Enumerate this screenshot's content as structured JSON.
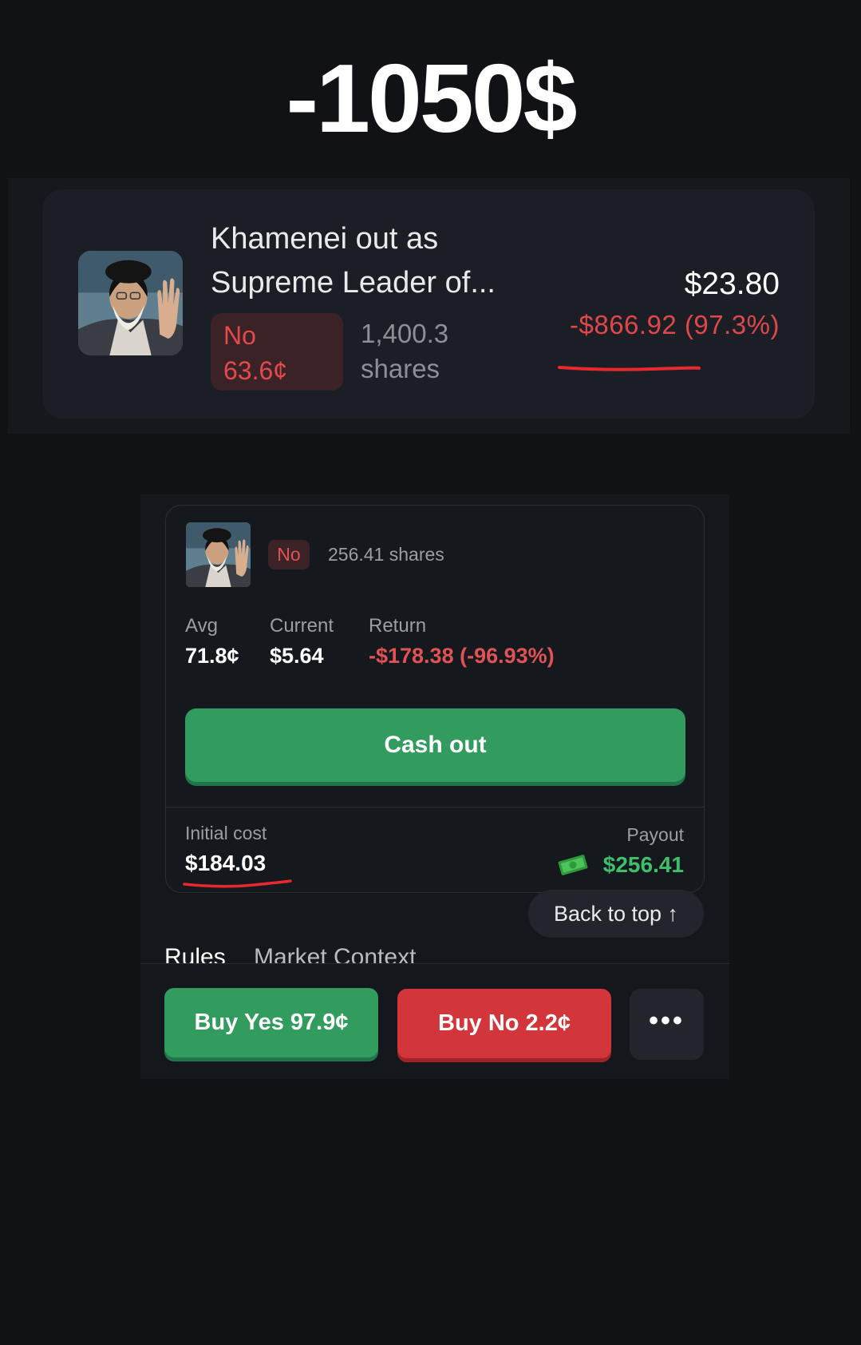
{
  "headline": "-1050$",
  "position_card": {
    "title": "Khamenei out as Supreme Leader of...",
    "outcome": "No",
    "outcome_price": "63.6¢",
    "shares_count": "1,400.3",
    "shares_label": "shares",
    "current_value": "$23.80",
    "pnl": "-$866.92 (97.3%)"
  },
  "detail_panel": {
    "outcome": "No",
    "shares": "256.41 shares",
    "stats": {
      "avg_label": "Avg",
      "avg_value": "71.8¢",
      "current_label": "Current",
      "current_value": "$5.64",
      "return_label": "Return",
      "return_value": "-$178.38 (-96.93%)"
    },
    "cash_out_label": "Cash out",
    "initial_cost_label": "Initial cost",
    "initial_cost_value": "$184.03",
    "payout_label": "Payout",
    "payout_value": "$256.41",
    "back_to_top_label": "Back to top ↑",
    "tabs": [
      "Rules",
      "Market Context"
    ],
    "buy_yes_label": "Buy Yes 97.9¢",
    "buy_no_label": "Buy No 2.2¢",
    "more_label": "•••"
  },
  "colors": {
    "background": "#111216",
    "card": "#1b1f25",
    "negative": "#e0474a",
    "positive": "#3fbf6a",
    "green_button": "#329b5e",
    "red_button": "#d2353a"
  },
  "icons": [
    "portrait-photo",
    "money-bill-icon",
    "arrow-up-icon",
    "more-dots-icon"
  ]
}
